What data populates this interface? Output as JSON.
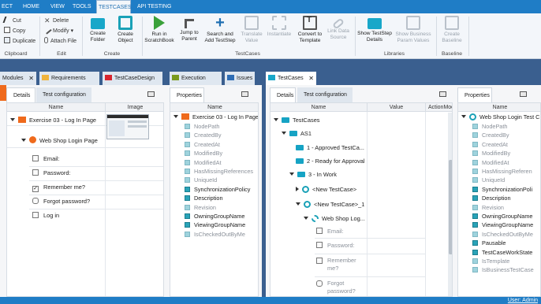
{
  "menu": [
    "ECT",
    "HOME",
    "VIEW",
    "TOOLS",
    "TESTCASES",
    "API TESTING"
  ],
  "ribbon": {
    "clipboard": {
      "cut": "Cut",
      "copy": "Copy",
      "duplicate": "Duplicate",
      "group": "Clipboard"
    },
    "edit": {
      "delete": "Delete",
      "modify": "Modify",
      "attach": "Attach File",
      "group": "Edit"
    },
    "create": {
      "folder": "Create\nFolder",
      "object": "Create\nObject",
      "group": "Create"
    },
    "testcases": {
      "run": "Run in\nScratchBook",
      "jump": "Jump to\nParent",
      "search": "Search and\nAdd TestStep",
      "translate": "Translate\nValue",
      "instantiate": "Instantiate",
      "convert": "Convert to\nTemplate",
      "link": "Link Data\nSource",
      "group": "TestCases"
    },
    "libraries": {
      "show": "Show TestStep\nDetails",
      "business": "Show Business\nParam Values",
      "group": "Libraries"
    },
    "baseline": {
      "create": "Create\nBaseline",
      "group": "Baseline"
    }
  },
  "left_tabs": [
    {
      "label": "Modules",
      "color": "#7fa6d2"
    },
    {
      "label": "Requirements",
      "color": "#f0b43c"
    },
    {
      "label": "TestCaseDesign",
      "color": "#d7252e"
    },
    {
      "label": "Execution",
      "color": "#7a9a1e"
    },
    {
      "label": "Issues",
      "color": "#2e6db5"
    }
  ],
  "right_tabs": [
    {
      "label": "TestCases",
      "color": "#18a7c9"
    }
  ],
  "left_pane": {
    "subtabs": [
      "Details",
      "Test configuration"
    ],
    "cols": [
      "Name",
      "Image"
    ],
    "rows": [
      {
        "label": "Exercise 03 - Log In Page"
      },
      {
        "label": "Web Shop Login Page"
      },
      {
        "label": "Email:"
      },
      {
        "label": "Password:"
      },
      {
        "label": "Remember me?"
      },
      {
        "label": "Forgot password?"
      },
      {
        "label": "Log in"
      }
    ]
  },
  "left_props": {
    "subtab": "Properties",
    "col": "Name",
    "title": "Exercise 03 - Log In Page",
    "items": [
      {
        "label": "NodePath",
        "dark": false
      },
      {
        "label": "CreatedBy",
        "dark": false
      },
      {
        "label": "CreatedAt",
        "dark": false
      },
      {
        "label": "ModifiedBy",
        "dark": false
      },
      {
        "label": "ModifiedAt",
        "dark": false
      },
      {
        "label": "HasMissingReferences",
        "dark": false
      },
      {
        "label": "UniqueId",
        "dark": false
      },
      {
        "label": "SynchronizationPolicy",
        "dark": true
      },
      {
        "label": "Description",
        "dark": true
      },
      {
        "label": "Revision",
        "dark": false
      },
      {
        "label": "OwningGroupName",
        "dark": true
      },
      {
        "label": "ViewingGroupName",
        "dark": true
      },
      {
        "label": "IsCheckedOutByMe",
        "dark": false
      }
    ]
  },
  "right_pane": {
    "subtabs": [
      "Details",
      "Test configuration"
    ],
    "cols": [
      "Name",
      "Value",
      "ActionMode"
    ],
    "rows": [
      {
        "label": "TestCases"
      },
      {
        "label": "AS1"
      },
      {
        "label": "1 - Approved TestCa..."
      },
      {
        "label": "2 - Ready for Approval"
      },
      {
        "label": "3 - In Work"
      },
      {
        "label": "<New TestCase>"
      },
      {
        "label": "<New TestCase>_1"
      },
      {
        "label": "Web Shop Log..."
      },
      {
        "label": "Email:"
      },
      {
        "label": "Password:"
      },
      {
        "label": "Remember\nme?"
      },
      {
        "label": "Forgot\npassword?"
      }
    ]
  },
  "right_props": {
    "subtab": "Properties",
    "col": "Name",
    "title": "Web Shop Login Test C",
    "items": [
      {
        "label": "NodePath",
        "dark": false
      },
      {
        "label": "CreatedBy",
        "dark": false
      },
      {
        "label": "CreatedAt",
        "dark": false
      },
      {
        "label": "ModifiedBy",
        "dark": false
      },
      {
        "label": "ModifiedAt",
        "dark": false
      },
      {
        "label": "HasMissingReferen",
        "dark": false
      },
      {
        "label": "UniqueId",
        "dark": false
      },
      {
        "label": "SynchronizationPoli",
        "dark": true
      },
      {
        "label": "Description",
        "dark": true
      },
      {
        "label": "Revision",
        "dark": false
      },
      {
        "label": "OwningGroupName",
        "dark": true
      },
      {
        "label": "ViewingGroupName",
        "dark": true
      },
      {
        "label": "IsCheckedOutByMe",
        "dark": false
      },
      {
        "label": "Pausable",
        "dark": true
      },
      {
        "label": "TestCaseWorkState",
        "dark": true
      },
      {
        "label": "IsTemplate",
        "dark": false
      },
      {
        "label": "IsBusinessTestCase",
        "dark": false
      }
    ]
  },
  "status": {
    "user": "User: Admin"
  }
}
